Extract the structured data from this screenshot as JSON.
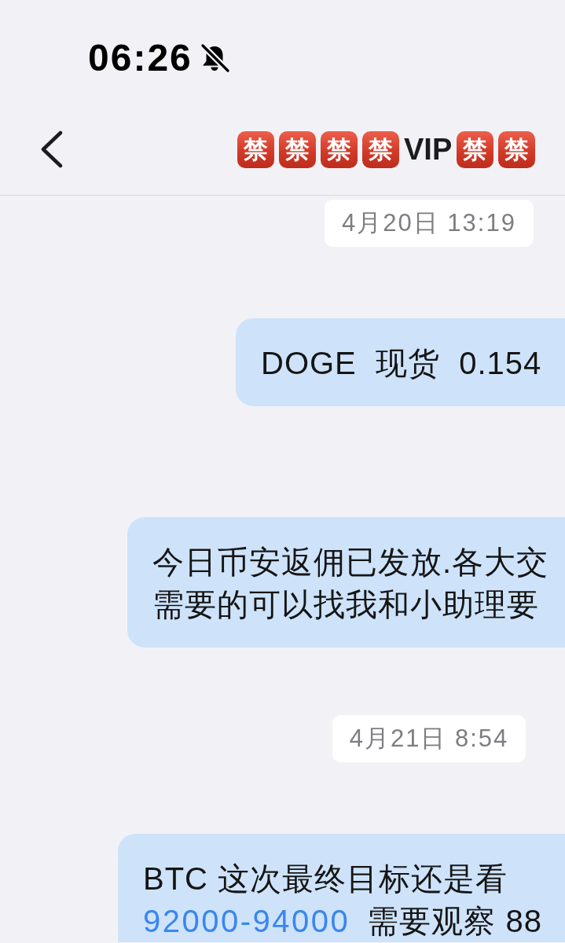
{
  "status_bar": {
    "time": "06:26",
    "muted": true
  },
  "header": {
    "title": [
      {
        "kind": "emoji",
        "text": "禁"
      },
      {
        "kind": "emoji",
        "text": "禁"
      },
      {
        "kind": "emoji",
        "text": "禁"
      },
      {
        "kind": "emoji",
        "text": "禁"
      },
      {
        "kind": "text",
        "text": "VIP"
      },
      {
        "kind": "emoji",
        "text": "禁"
      },
      {
        "kind": "emoji",
        "text": "禁"
      }
    ]
  },
  "messages": [
    {
      "kind": "timestamp",
      "text": "4月20日 13:19"
    },
    {
      "kind": "bubble",
      "lines": [
        [
          {
            "kind": "text",
            "text": "DOGE  现货  0.154"
          }
        ]
      ]
    },
    {
      "kind": "bubble",
      "lines": [
        [
          {
            "kind": "text",
            "text": "今日币安返佣已发放.各大交"
          }
        ],
        [
          {
            "kind": "text",
            "text": "需要的可以找我和小助理要"
          }
        ]
      ]
    },
    {
      "kind": "timestamp",
      "text": "4月21日 8:54"
    },
    {
      "kind": "bubble",
      "lines": [
        [
          {
            "kind": "text",
            "text": "BTC 这次最终目标还是看"
          }
        ],
        [
          {
            "kind": "link",
            "text": "92000-94000"
          },
          {
            "kind": "text",
            "text": "需要观察 88"
          }
        ]
      ]
    }
  ]
}
